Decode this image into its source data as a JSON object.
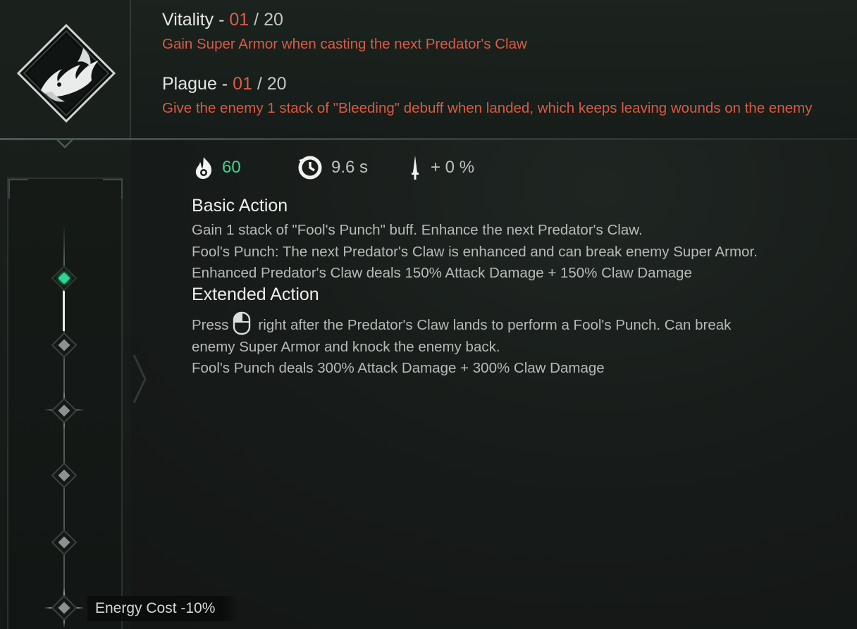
{
  "attributes": [
    {
      "name": "Vitality",
      "separator": " - ",
      "current": "01",
      "max": "/ 20",
      "description": "Gain Super Armor when casting the next Predator's Claw"
    },
    {
      "name": "Plague",
      "separator": " - ",
      "current": "01",
      "max": "/ 20",
      "description": "Give the enemy 1 stack of \"Bleeding\" debuff when landed, which keeps leaving wounds on the enemy"
    }
  ],
  "stats": {
    "cost": {
      "icon": "flame-icon",
      "value": "60",
      "color": "#42d28e"
    },
    "cooldown": {
      "icon": "cooldown-clock-icon",
      "value": "9.6 s"
    },
    "damage_bonus": {
      "icon": "dagger-icon",
      "value": "+ 0 %"
    }
  },
  "basic_action": {
    "title": "Basic Action",
    "lines": [
      "Gain 1 stack of \"Fool's Punch\" buff. Enhance the next Predator's Claw.",
      "Fool's Punch: The next Predator's Claw is enhanced and can break enemy Super Armor.",
      "Enhanced Predator's Claw deals 150% Attack Damage + 150% Claw Damage"
    ]
  },
  "extended_action": {
    "title": "Extended Action",
    "press": "Press",
    "input_icon": "mouse-right-button-icon",
    "line1_rest": "right after the Predator's Claw lands to perform a Fool's Punch. Can break",
    "line2": "enemy Super Armor and knock the enemy back.",
    "line3": "Fool's Punch deals 300% Attack Damage + 300% Claw Damage"
  },
  "progression": {
    "nodes": [
      "active",
      "inactive",
      "inactive-star",
      "inactive",
      "inactive",
      "inactive-star"
    ],
    "unlocked_count": 1,
    "bottom_bonus": "Energy Cost -10%"
  },
  "colors": {
    "accent_red": "#e05a48",
    "accent_green": "#2fd48f",
    "text_light": "#e6e6e4",
    "text_body": "#b8bab8"
  }
}
